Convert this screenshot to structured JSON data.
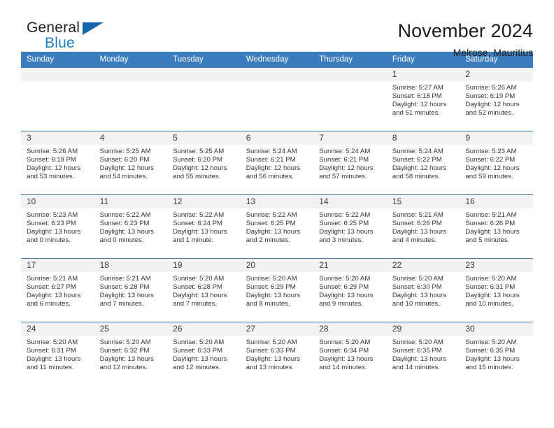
{
  "brand": {
    "name_part1": "General",
    "name_part2": "Blue",
    "triangle": "blue-triangle-logo-mark"
  },
  "header": {
    "title": "November 2024",
    "subtitle": "Melrose, Mauritius"
  },
  "colors": {
    "header_blue": "#3b7cbd",
    "brand_blue": "#1c7fc4",
    "daynum_band": "#f2f2f2",
    "text": "#343434"
  },
  "calendar": {
    "weekdays": [
      "Sunday",
      "Monday",
      "Tuesday",
      "Wednesday",
      "Thursday",
      "Friday",
      "Saturday"
    ],
    "weeks": [
      [
        {
          "day": "",
          "empty": true
        },
        {
          "day": "",
          "empty": true
        },
        {
          "day": "",
          "empty": true
        },
        {
          "day": "",
          "empty": true
        },
        {
          "day": "",
          "empty": true
        },
        {
          "day": "1",
          "sunrise": "Sunrise: 5:27 AM",
          "sunset": "Sunset: 6:18 PM",
          "daylight1": "Daylight: 12 hours",
          "daylight2": "and 51 minutes."
        },
        {
          "day": "2",
          "sunrise": "Sunrise: 5:26 AM",
          "sunset": "Sunset: 6:19 PM",
          "daylight1": "Daylight: 12 hours",
          "daylight2": "and 52 minutes."
        }
      ],
      [
        {
          "day": "3",
          "sunrise": "Sunrise: 5:26 AM",
          "sunset": "Sunset: 6:19 PM",
          "daylight1": "Daylight: 12 hours",
          "daylight2": "and 53 minutes."
        },
        {
          "day": "4",
          "sunrise": "Sunrise: 5:25 AM",
          "sunset": "Sunset: 6:20 PM",
          "daylight1": "Daylight: 12 hours",
          "daylight2": "and 54 minutes."
        },
        {
          "day": "5",
          "sunrise": "Sunrise: 5:25 AM",
          "sunset": "Sunset: 6:20 PM",
          "daylight1": "Daylight: 12 hours",
          "daylight2": "and 55 minutes."
        },
        {
          "day": "6",
          "sunrise": "Sunrise: 5:24 AM",
          "sunset": "Sunset: 6:21 PM",
          "daylight1": "Daylight: 12 hours",
          "daylight2": "and 56 minutes."
        },
        {
          "day": "7",
          "sunrise": "Sunrise: 5:24 AM",
          "sunset": "Sunset: 6:21 PM",
          "daylight1": "Daylight: 12 hours",
          "daylight2": "and 57 minutes."
        },
        {
          "day": "8",
          "sunrise": "Sunrise: 5:24 AM",
          "sunset": "Sunset: 6:22 PM",
          "daylight1": "Daylight: 12 hours",
          "daylight2": "and 58 minutes."
        },
        {
          "day": "9",
          "sunrise": "Sunrise: 5:23 AM",
          "sunset": "Sunset: 6:22 PM",
          "daylight1": "Daylight: 12 hours",
          "daylight2": "and 59 minutes."
        }
      ],
      [
        {
          "day": "10",
          "sunrise": "Sunrise: 5:23 AM",
          "sunset": "Sunset: 6:23 PM",
          "daylight1": "Daylight: 13 hours",
          "daylight2": "and 0 minutes."
        },
        {
          "day": "11",
          "sunrise": "Sunrise: 5:22 AM",
          "sunset": "Sunset: 6:23 PM",
          "daylight1": "Daylight: 13 hours",
          "daylight2": "and 0 minutes."
        },
        {
          "day": "12",
          "sunrise": "Sunrise: 5:22 AM",
          "sunset": "Sunset: 6:24 PM",
          "daylight1": "Daylight: 13 hours",
          "daylight2": "and 1 minute."
        },
        {
          "day": "13",
          "sunrise": "Sunrise: 5:22 AM",
          "sunset": "Sunset: 6:25 PM",
          "daylight1": "Daylight: 13 hours",
          "daylight2": "and 2 minutes."
        },
        {
          "day": "14",
          "sunrise": "Sunrise: 5:22 AM",
          "sunset": "Sunset: 6:25 PM",
          "daylight1": "Daylight: 13 hours",
          "daylight2": "and 3 minutes."
        },
        {
          "day": "15",
          "sunrise": "Sunrise: 5:21 AM",
          "sunset": "Sunset: 6:26 PM",
          "daylight1": "Daylight: 13 hours",
          "daylight2": "and 4 minutes."
        },
        {
          "day": "16",
          "sunrise": "Sunrise: 5:21 AM",
          "sunset": "Sunset: 6:26 PM",
          "daylight1": "Daylight: 13 hours",
          "daylight2": "and 5 minutes."
        }
      ],
      [
        {
          "day": "17",
          "sunrise": "Sunrise: 5:21 AM",
          "sunset": "Sunset: 6:27 PM",
          "daylight1": "Daylight: 13 hours",
          "daylight2": "and 6 minutes."
        },
        {
          "day": "18",
          "sunrise": "Sunrise: 5:21 AM",
          "sunset": "Sunset: 6:28 PM",
          "daylight1": "Daylight: 13 hours",
          "daylight2": "and 7 minutes."
        },
        {
          "day": "19",
          "sunrise": "Sunrise: 5:20 AM",
          "sunset": "Sunset: 6:28 PM",
          "daylight1": "Daylight: 13 hours",
          "daylight2": "and 7 minutes."
        },
        {
          "day": "20",
          "sunrise": "Sunrise: 5:20 AM",
          "sunset": "Sunset: 6:29 PM",
          "daylight1": "Daylight: 13 hours",
          "daylight2": "and 8 minutes."
        },
        {
          "day": "21",
          "sunrise": "Sunrise: 5:20 AM",
          "sunset": "Sunset: 6:29 PM",
          "daylight1": "Daylight: 13 hours",
          "daylight2": "and 9 minutes."
        },
        {
          "day": "22",
          "sunrise": "Sunrise: 5:20 AM",
          "sunset": "Sunset: 6:30 PM",
          "daylight1": "Daylight: 13 hours",
          "daylight2": "and 10 minutes."
        },
        {
          "day": "23",
          "sunrise": "Sunrise: 5:20 AM",
          "sunset": "Sunset: 6:31 PM",
          "daylight1": "Daylight: 13 hours",
          "daylight2": "and 10 minutes."
        }
      ],
      [
        {
          "day": "24",
          "sunrise": "Sunrise: 5:20 AM",
          "sunset": "Sunset: 6:31 PM",
          "daylight1": "Daylight: 13 hours",
          "daylight2": "and 11 minutes."
        },
        {
          "day": "25",
          "sunrise": "Sunrise: 5:20 AM",
          "sunset": "Sunset: 6:32 PM",
          "daylight1": "Daylight: 13 hours",
          "daylight2": "and 12 minutes."
        },
        {
          "day": "26",
          "sunrise": "Sunrise: 5:20 AM",
          "sunset": "Sunset: 6:33 PM",
          "daylight1": "Daylight: 13 hours",
          "daylight2": "and 12 minutes."
        },
        {
          "day": "27",
          "sunrise": "Sunrise: 5:20 AM",
          "sunset": "Sunset: 6:33 PM",
          "daylight1": "Daylight: 13 hours",
          "daylight2": "and 13 minutes."
        },
        {
          "day": "28",
          "sunrise": "Sunrise: 5:20 AM",
          "sunset": "Sunset: 6:34 PM",
          "daylight1": "Daylight: 13 hours",
          "daylight2": "and 14 minutes."
        },
        {
          "day": "29",
          "sunrise": "Sunrise: 5:20 AM",
          "sunset": "Sunset: 6:35 PM",
          "daylight1": "Daylight: 13 hours",
          "daylight2": "and 14 minutes."
        },
        {
          "day": "30",
          "sunrise": "Sunrise: 5:20 AM",
          "sunset": "Sunset: 6:35 PM",
          "daylight1": "Daylight: 13 hours",
          "daylight2": "and 15 minutes."
        }
      ]
    ]
  }
}
